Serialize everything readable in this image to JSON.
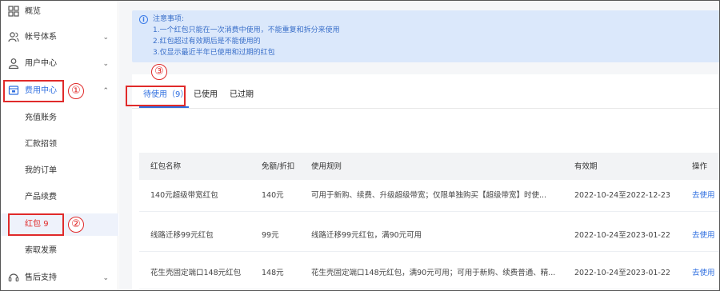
{
  "sidebar": {
    "items": [
      {
        "label": "概览",
        "icon": "grid-icon"
      },
      {
        "label": "帐号体系",
        "icon": "users-icon",
        "chevron": "⌄"
      },
      {
        "label": "用户中心",
        "icon": "user-icon",
        "chevron": "⌄"
      },
      {
        "label": "费用中心",
        "icon": "wallet-icon",
        "chevron": "⌃"
      }
    ],
    "sub_items": [
      {
        "label": "充值账务"
      },
      {
        "label": "汇款招领"
      },
      {
        "label": "我的订单"
      },
      {
        "label": "产品续费"
      },
      {
        "label": "红包",
        "count": "9"
      },
      {
        "label": "索取发票"
      }
    ],
    "support": {
      "label": "售后支持",
      "icon": "support-icon",
      "chevron": "⌄"
    }
  },
  "markers": {
    "one": "①",
    "two": "②",
    "three": "③"
  },
  "notice": {
    "title": "注意事项:",
    "lines": [
      "1.一个红包只能在一次消费中使用，不能重复和拆分来使用",
      "2.红包超过有效期后是不能使用的",
      "3.仅显示最近半年已使用和过期的红包"
    ]
  },
  "tabs": [
    {
      "label": "待使用（9）",
      "active": true
    },
    {
      "label": "已使用",
      "active": false
    },
    {
      "label": "已过期",
      "active": false
    }
  ],
  "table": {
    "headers": [
      "红包名称",
      "免额/折扣",
      "使用规则",
      "有效期",
      "操作"
    ],
    "rows": [
      [
        "140元超级带宽红包",
        "140元",
        "可用于新购、续费、升级超级带宽；仅限单独购买【超级带宽】时使...",
        "2022-10-24至2022-12-23",
        "去使用"
      ],
      [
        "线路迁移99元红包",
        "99元",
        "线路迁移99元红包，满90元可用",
        "2022-10-24至2023-01-22",
        "去使用"
      ],
      [
        "花生壳固定端口148元红包",
        "148元",
        "花生壳固定端口148元红包，满90元可用；可用于新购、续费普通、精...",
        "2022-10-24至2023-01-22",
        "去使用"
      ]
    ]
  },
  "colors": {
    "accent": "#2f6fe0",
    "annotation": "#e02a2a",
    "notice_bg": "#dbe8fb"
  }
}
